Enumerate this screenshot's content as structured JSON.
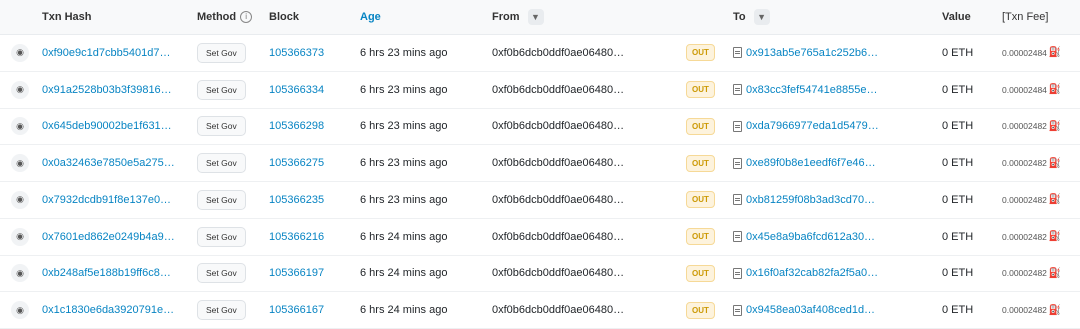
{
  "columns": {
    "txn_hash": "Txn Hash",
    "method": "Method",
    "block": "Block",
    "age": "Age",
    "from": "From",
    "to": "To",
    "value": "Value",
    "fee": "[Txn Fee]"
  },
  "icons": {
    "eye": "eye-icon",
    "info": "info-icon",
    "filter": "filter-icon",
    "contract": "contract-document-icon",
    "gas": "gas-pump-icon"
  },
  "colors": {
    "link": "#0784c3",
    "out_badge_bg": "#fdf3dd",
    "out_badge_text": "#cc9a06",
    "gas_icon": "#2fa84f"
  },
  "rows": [
    {
      "hash": "0xf90e9c1d7cbb5401d7…",
      "method": "Set Gov",
      "block": "105366373",
      "age": "6 hrs 23 mins ago",
      "from": "0xf0b6dcb0ddf0ae06480…",
      "direction": "OUT",
      "to": "0x913ab5e765a1c252b6…",
      "value": "0 ETH",
      "fee": "0.00002484"
    },
    {
      "hash": "0x91a2528b03b3f39816…",
      "method": "Set Gov",
      "block": "105366334",
      "age": "6 hrs 23 mins ago",
      "from": "0xf0b6dcb0ddf0ae06480…",
      "direction": "OUT",
      "to": "0x83cc3fef54741e8855e…",
      "value": "0 ETH",
      "fee": "0.00002484"
    },
    {
      "hash": "0x645deb90002be1f631…",
      "method": "Set Gov",
      "block": "105366298",
      "age": "6 hrs 23 mins ago",
      "from": "0xf0b6dcb0ddf0ae06480…",
      "direction": "OUT",
      "to": "0xda7966977eda1d5479…",
      "value": "0 ETH",
      "fee": "0.00002482"
    },
    {
      "hash": "0x0a32463e7850e5a275…",
      "method": "Set Gov",
      "block": "105366275",
      "age": "6 hrs 23 mins ago",
      "from": "0xf0b6dcb0ddf0ae06480…",
      "direction": "OUT",
      "to": "0xe89f0b8e1eedf6f7e46…",
      "value": "0 ETH",
      "fee": "0.00002482"
    },
    {
      "hash": "0x7932dcdb91f8e137e0…",
      "method": "Set Gov",
      "block": "105366235",
      "age": "6 hrs 23 mins ago",
      "from": "0xf0b6dcb0ddf0ae06480…",
      "direction": "OUT",
      "to": "0xb81259f08b3ad3cd70…",
      "value": "0 ETH",
      "fee": "0.00002482"
    },
    {
      "hash": "0x7601ed862e0249b4a9…",
      "method": "Set Gov",
      "block": "105366216",
      "age": "6 hrs 24 mins ago",
      "from": "0xf0b6dcb0ddf0ae06480…",
      "direction": "OUT",
      "to": "0x45e8a9ba6fcd612a30…",
      "value": "0 ETH",
      "fee": "0.00002482"
    },
    {
      "hash": "0xb248af5e188b19ff6c8…",
      "method": "Set Gov",
      "block": "105366197",
      "age": "6 hrs 24 mins ago",
      "from": "0xf0b6dcb0ddf0ae06480…",
      "direction": "OUT",
      "to": "0x16f0af32cab82fa2f5a0…",
      "value": "0 ETH",
      "fee": "0.00002482"
    },
    {
      "hash": "0x1c1830e6da3920791e…",
      "method": "Set Gov",
      "block": "105366167",
      "age": "6 hrs 24 mins ago",
      "from": "0xf0b6dcb0ddf0ae06480…",
      "direction": "OUT",
      "to": "0x9458ea03af408ced1d…",
      "value": "0 ETH",
      "fee": "0.00002482"
    }
  ]
}
